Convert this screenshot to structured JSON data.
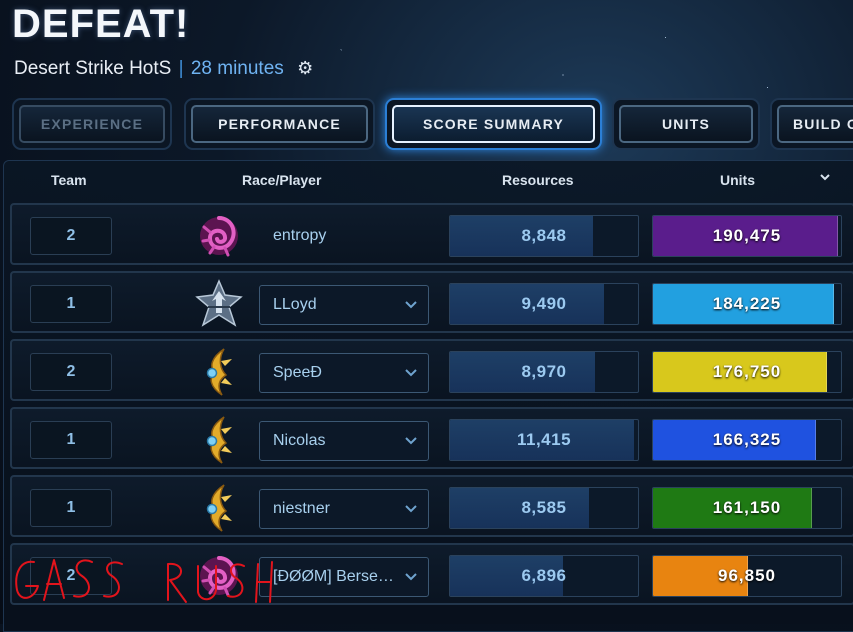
{
  "header": {
    "title": "DEFEAT!",
    "map_name": "Desert Strike HotS",
    "separator": "|",
    "duration": "28 minutes",
    "settings_icon": "gear-icon"
  },
  "tabs": [
    {
      "label": "EXPERIENCE",
      "state": "disabled"
    },
    {
      "label": "PERFORMANCE",
      "state": "normal"
    },
    {
      "label": "SCORE SUMMARY",
      "state": "active"
    },
    {
      "label": "UNITS",
      "state": "normal"
    },
    {
      "label": "BUILD O",
      "state": "normal"
    }
  ],
  "table": {
    "columns": {
      "team": "Team",
      "player": "Race/Player",
      "resources": "Resources",
      "units": "Units"
    },
    "sort_icon": "chevron-down-icon",
    "rows": [
      {
        "team": "2",
        "race": "zerg-emblem-icon",
        "player": "entropy",
        "has_dropdown": false,
        "resources": "8,848",
        "resources_fill": 0.76,
        "units": "190,475",
        "units_fill": 0.98,
        "color": "#5a1d8c"
      },
      {
        "team": "1",
        "race": "terran-emblem-icon",
        "player": "LLoyd",
        "has_dropdown": true,
        "resources": "9,490",
        "resources_fill": 0.82,
        "units": "184,225",
        "units_fill": 0.96,
        "color": "#22a0e0"
      },
      {
        "team": "2",
        "race": "protoss-emblem-icon",
        "player": "SpeeÐ",
        "has_dropdown": true,
        "resources": "8,970",
        "resources_fill": 0.77,
        "units": "176,750",
        "units_fill": 0.92,
        "color": "#d8c81c"
      },
      {
        "team": "1",
        "race": "protoss-emblem-icon",
        "player": "Nicolas",
        "has_dropdown": true,
        "resources": "11,415",
        "resources_fill": 0.98,
        "units": "166,325",
        "units_fill": 0.86,
        "color": "#1f52e0"
      },
      {
        "team": "1",
        "race": "protoss-emblem-icon",
        "player": "niestner",
        "has_dropdown": true,
        "resources": "8,585",
        "resources_fill": 0.74,
        "units": "161,150",
        "units_fill": 0.84,
        "color": "#1f7a14"
      },
      {
        "team": "2",
        "race": "zerg-emblem-icon",
        "player": "[ÐØØM] Berser…",
        "has_dropdown": true,
        "resources": "6,896",
        "resources_fill": 0.6,
        "units": "96,850",
        "units_fill": 0.5,
        "color": "#e88410"
      }
    ]
  },
  "annotation": {
    "text": "GASS RUSH",
    "color": "#e2141c"
  }
}
